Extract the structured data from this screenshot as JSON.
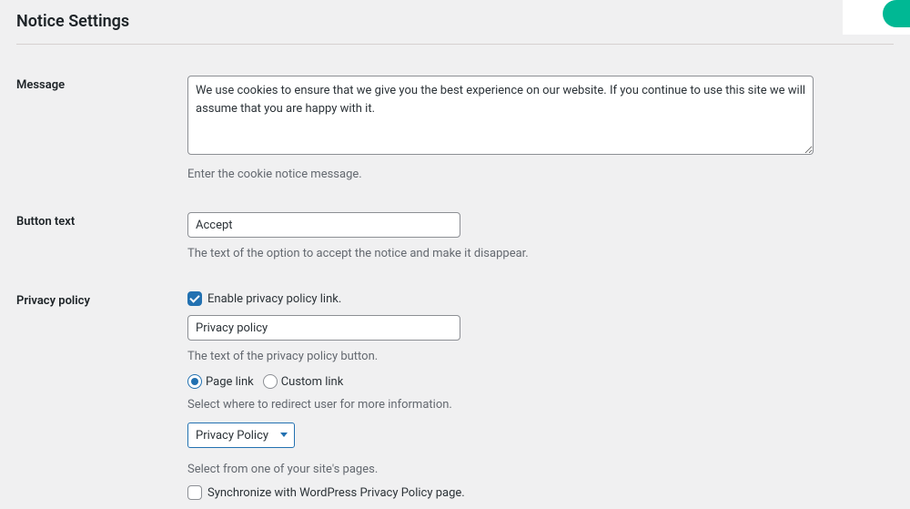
{
  "section_title": "Notice Settings",
  "message": {
    "label": "Message",
    "value": "We use cookies to ensure that we give you the best experience on our website. If you continue to use this site we will assume that you are happy with it.",
    "description": "Enter the cookie notice message."
  },
  "button_text": {
    "label": "Button text",
    "value": "Accept",
    "description": "The text of the option to accept the notice and make it disappear."
  },
  "privacy_policy": {
    "label": "Privacy policy",
    "enable_label": "Enable privacy policy link.",
    "button_text_value": "Privacy policy",
    "button_text_description": "The text of the privacy policy button.",
    "link_type_page": "Page link",
    "link_type_custom": "Custom link",
    "redirect_description": "Select where to redirect user for more information.",
    "page_select_value": "Privacy Policy",
    "page_select_description": "Select from one of your site's pages.",
    "sync_label": "Synchronize with WordPress Privacy Policy page."
  }
}
